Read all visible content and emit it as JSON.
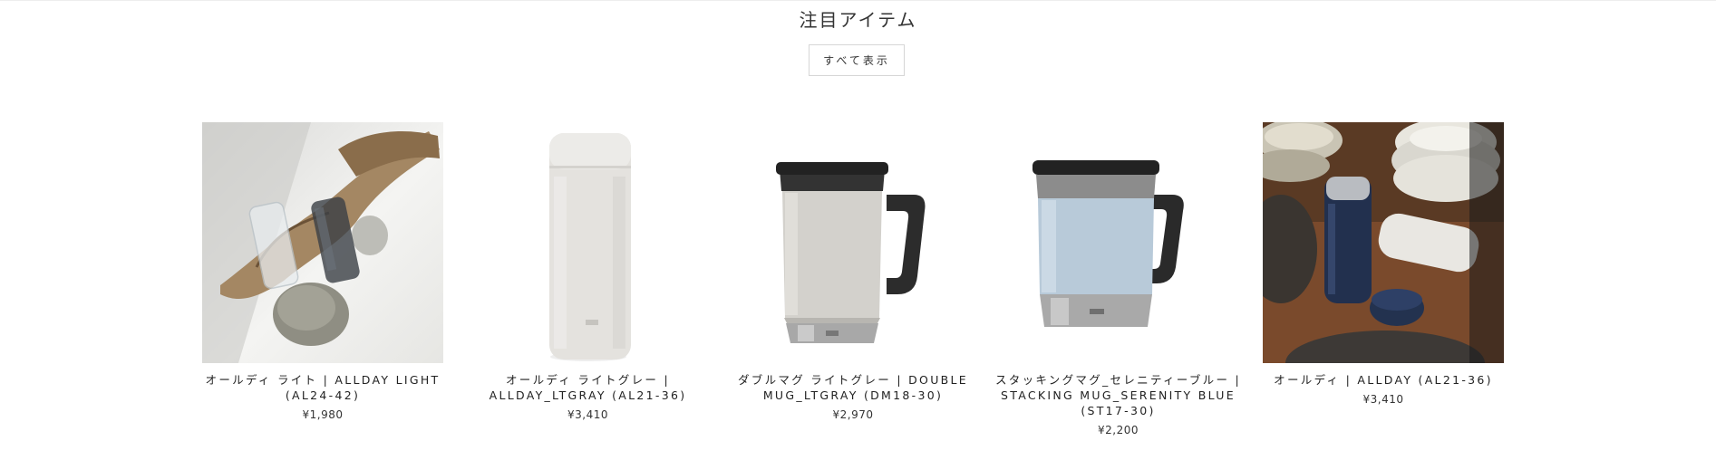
{
  "section": {
    "title": "注目アイテム",
    "view_all_label": "すべて表示"
  },
  "products": [
    {
      "name": "オールディ ライト | ALLDAY LIGHT (AL24-42)",
      "price": "¥1,980",
      "image_icon": "clear-bottles-on-driftwood-photo"
    },
    {
      "name": "オールディ ライトグレー | ALLDAY_LTGRAY (AL21-36)",
      "price": "¥3,410",
      "image_icon": "light-gray-bottle-photo"
    },
    {
      "name": "ダブルマグ ライトグレー | DOUBLE MUG_LTGRAY (DM18-30)",
      "price": "¥2,970",
      "image_icon": "light-gray-mug-photo"
    },
    {
      "name": "スタッキングマグ_セレニティーブルー | STACKING MUG_SERENITY BLUE (ST17-30)",
      "price": "¥2,200",
      "image_icon": "serenity-blue-mug-photo"
    },
    {
      "name": "オールディ | ALLDAY (AL21-36)",
      "price": "¥3,410",
      "image_icon": "navy-bottle-tabletop-photo"
    }
  ]
}
